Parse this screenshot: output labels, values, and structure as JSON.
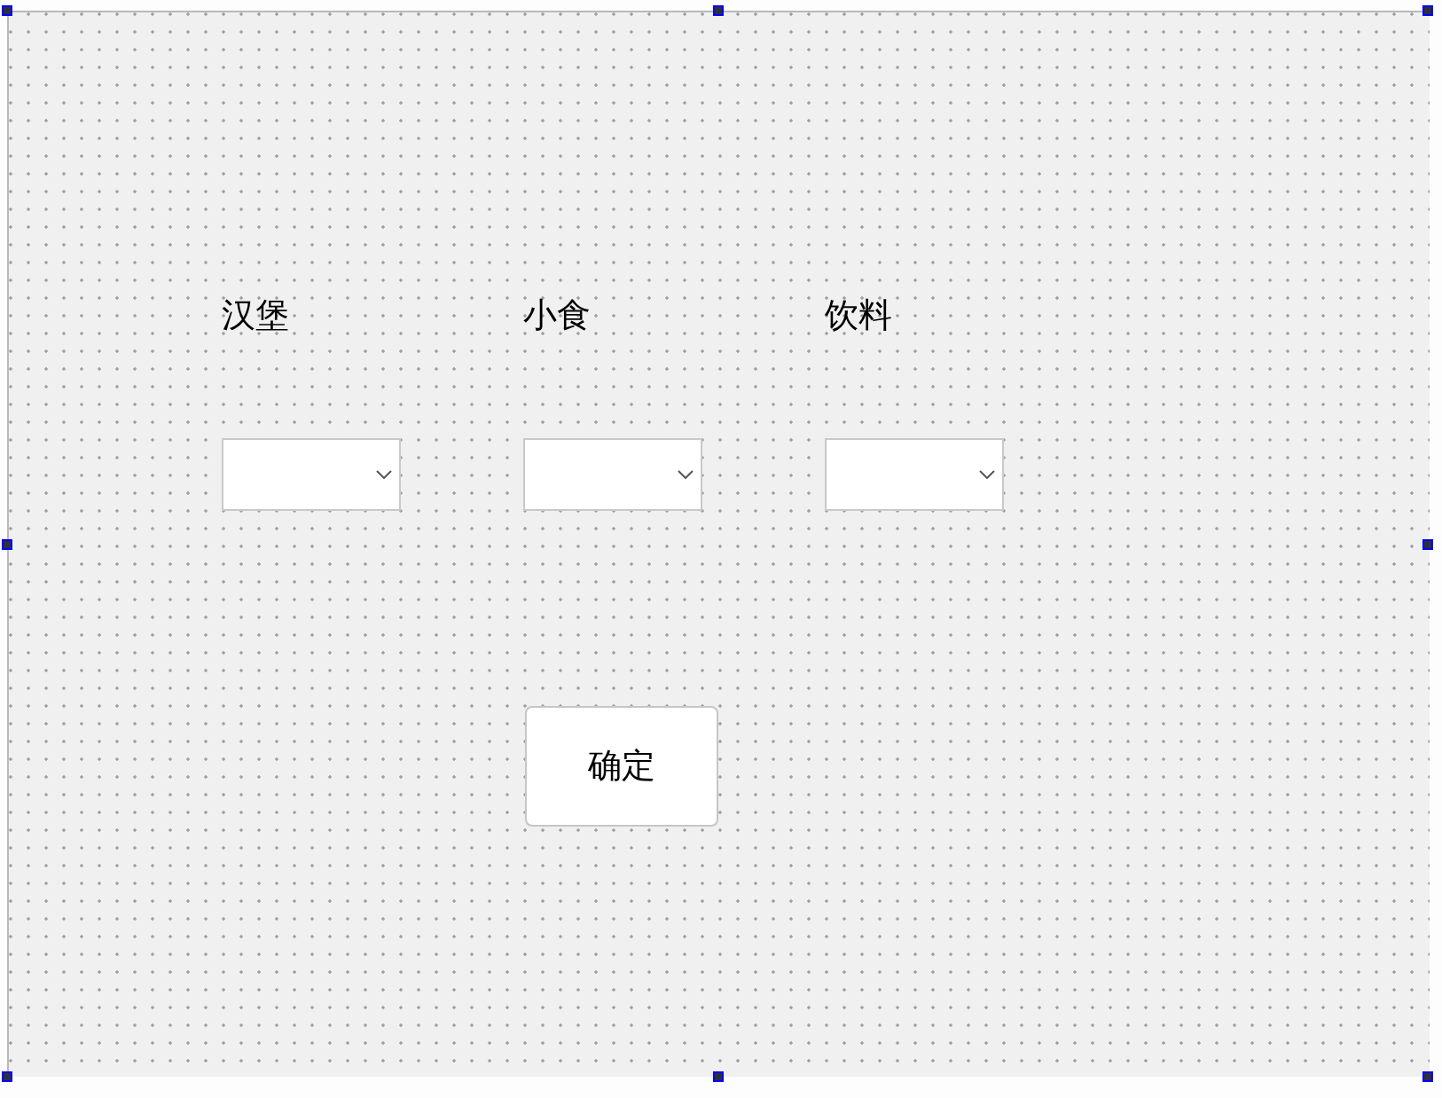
{
  "form": {
    "selected": true,
    "fields": [
      {
        "label": "汉堡"
      },
      {
        "label": "小食"
      },
      {
        "label": "饮料"
      }
    ],
    "button": {
      "label": "确定"
    }
  }
}
